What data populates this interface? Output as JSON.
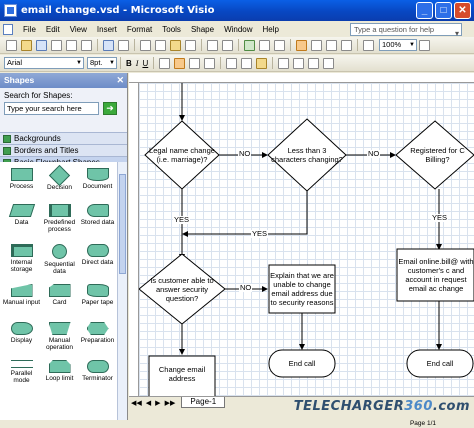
{
  "window": {
    "title": "email change.vsd - Microsoft Visio"
  },
  "menu": {
    "items": [
      "File",
      "Edit",
      "View",
      "Insert",
      "Format",
      "Tools",
      "Shape",
      "Window",
      "Help"
    ],
    "help_placeholder": "Type a question for help"
  },
  "toolbar": {
    "zoom": "100%",
    "font": "Arial",
    "font_size": "8pt.",
    "bold": "B",
    "italic": "I",
    "underline": "U"
  },
  "shapes_pane": {
    "title": "Shapes",
    "search_label": "Search for Shapes:",
    "search_placeholder": "Type your search here",
    "stencils": [
      "Backgrounds",
      "Borders and Titles",
      "Basic Flowchart Shapes"
    ],
    "shapes": [
      [
        "Process",
        "Decision",
        "Document"
      ],
      [
        "Data",
        "Predefined process",
        "Stored data"
      ],
      [
        "Internal storage",
        "Sequential data",
        "Direct data"
      ],
      [
        "Manual input",
        "Card",
        "Paper tape"
      ],
      [
        "Display",
        "Manual operation",
        "Preparation"
      ],
      [
        "Parallel mode",
        "Loop limit",
        "Terminator"
      ]
    ]
  },
  "diagram": {
    "decision1": "Legal name change (i.e. marriage)?",
    "decision2": "Less than 3 characters changing?",
    "decision3": "Registered for C Billing?",
    "decision4": "Is customer able to answer security question?",
    "process_explain": "Explain that we are unable to change email address due to security reasons",
    "process_email": "Email online.bill@ with customer's c and account in request email ac change",
    "process_change": "Change email address",
    "end1": "End call",
    "end2": "End call",
    "no": "NO",
    "yes": "YES"
  },
  "footer": {
    "page_tab": "Page-1",
    "status": "Page 1/1",
    "watermark_main": "TELECHARGER",
    "watermark_accent": "360",
    "watermark_suffix": ".com"
  }
}
